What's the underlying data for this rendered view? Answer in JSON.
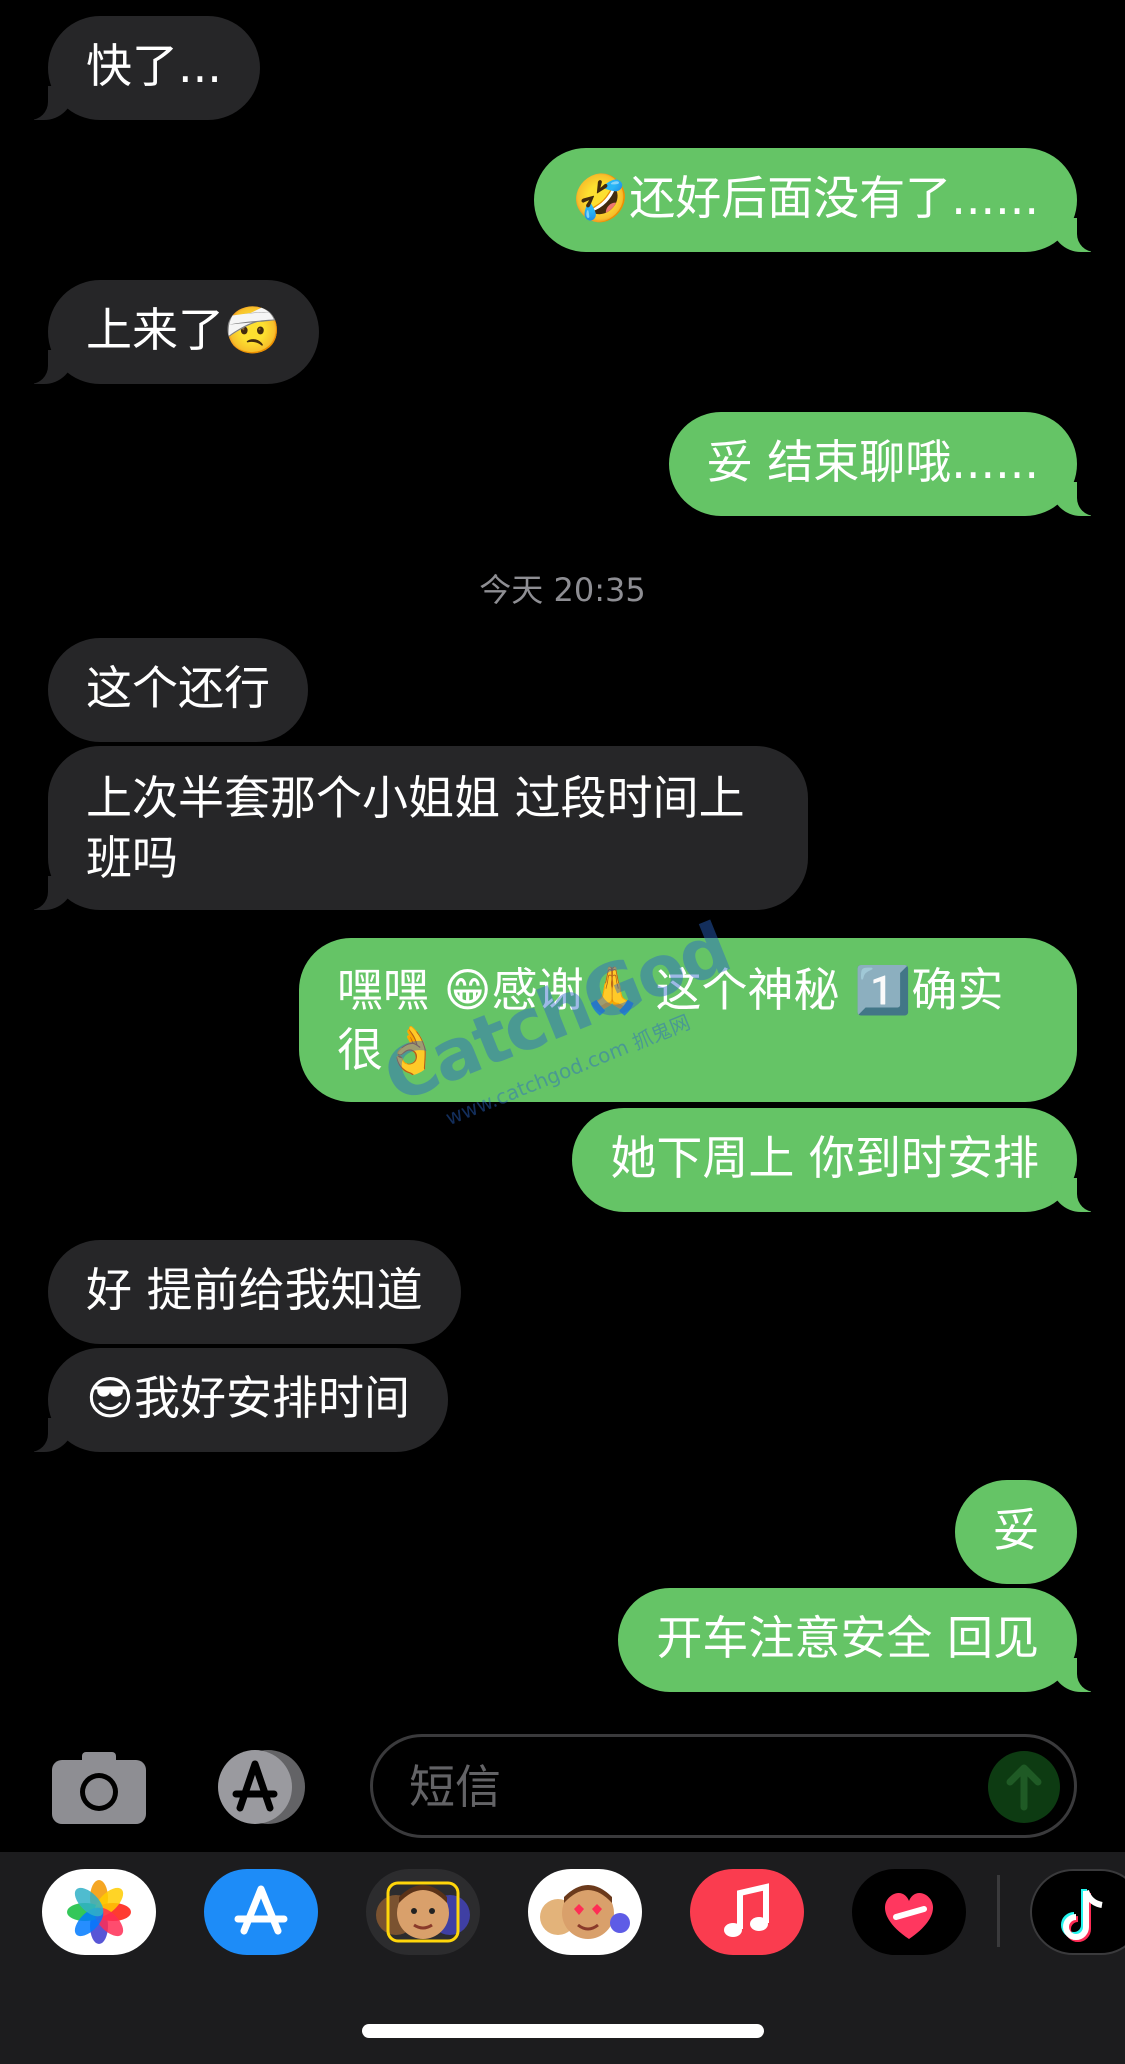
{
  "conversation": {
    "messages": [
      {
        "id": "m1",
        "side": "in",
        "text": "快了..."
      },
      {
        "id": "m2",
        "side": "out",
        "text": "🤣还好后面没有了......"
      },
      {
        "id": "m3",
        "side": "in",
        "text": "上来了🤕"
      },
      {
        "id": "m4",
        "side": "out",
        "text": "妥 结束聊哦......"
      },
      {
        "id": "m5",
        "side": "in",
        "text": "这个还行"
      },
      {
        "id": "m6",
        "side": "in",
        "text": "上次半套那个小姐姐 过段时间上班吗"
      },
      {
        "id": "m7",
        "side": "out",
        "text": "嘿嘿 😁感谢🙏 这个神秘 1️⃣确实很👌"
      },
      {
        "id": "m8",
        "side": "out",
        "text": "她下周上 你到时安排"
      },
      {
        "id": "m9",
        "side": "in",
        "text": "好 提前给我知道"
      },
      {
        "id": "m10",
        "side": "in",
        "text": "😎我好安排时间"
      },
      {
        "id": "m11",
        "side": "out",
        "text": "妥"
      },
      {
        "id": "m12",
        "side": "out",
        "text": "开车注意安全 回见"
      }
    ],
    "timestamp": "今天 20:35"
  },
  "watermark": {
    "brand": "CatchGod",
    "url": "www.catchgod.com",
    "cn": "抓鬼网"
  },
  "input_bar": {
    "placeholder": "短信"
  },
  "app_drawer": {
    "apps": [
      {
        "name": "photos-app",
        "icon": "photos-icon"
      },
      {
        "name": "app-store-app",
        "icon": "app-store-icon"
      },
      {
        "name": "memoji-app",
        "icon": "memoji-icon"
      },
      {
        "name": "memoji-stickers-app",
        "icon": "memoji-stickers-icon"
      },
      {
        "name": "music-app",
        "icon": "music-icon"
      },
      {
        "name": "digital-touch-app",
        "icon": "digital-touch-icon"
      },
      {
        "name": "tiktok-app",
        "icon": "tiktok-icon"
      }
    ]
  },
  "colors": {
    "incoming": "#262628",
    "outgoing": "#65c466",
    "background": "#000000"
  }
}
